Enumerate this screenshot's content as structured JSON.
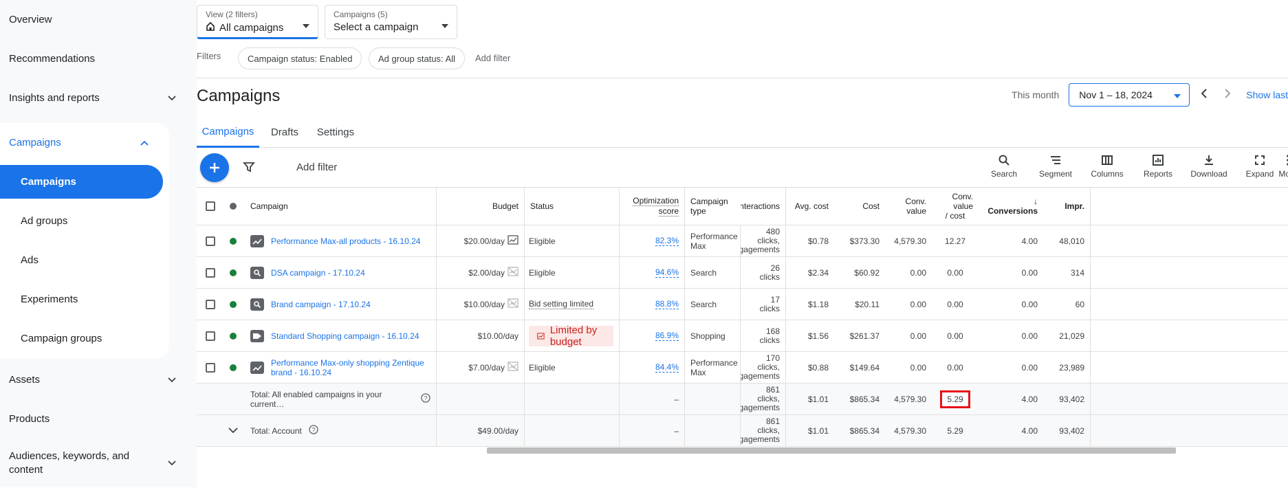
{
  "sidebar": {
    "overview": "Overview",
    "recommendations": "Recommendations",
    "insights": "Insights and reports",
    "campaigns_section": "Campaigns",
    "campaigns_children": [
      "Campaigns",
      "Ad groups",
      "Ads",
      "Experiments",
      "Campaign groups"
    ],
    "assets": "Assets",
    "products": "Products",
    "audiences": "Audiences, keywords, and content"
  },
  "view_dropdown": {
    "small": "View (2 filters)",
    "value": "All campaigns"
  },
  "campaigns_dropdown": {
    "small": "Campaigns (5)",
    "value": "Select a campaign"
  },
  "filters": {
    "label": "Filters",
    "chips": [
      "Campaign status: Enabled",
      "Ad group status: All"
    ],
    "add": "Add filter"
  },
  "page_title": "Campaigns",
  "date": {
    "label": "This month",
    "range": "Nov 1 – 18, 2024",
    "show_last": "Show last"
  },
  "tabs": [
    "Campaigns",
    "Drafts",
    "Settings"
  ],
  "toolbar": {
    "add_filter": "Add filter",
    "tools": [
      "Search",
      "Segment",
      "Columns",
      "Reports",
      "Download",
      "Expand",
      "More"
    ]
  },
  "table": {
    "headers": {
      "campaign": "Campaign",
      "budget": "Budget",
      "status": "Status",
      "opt_line1": "Optimization",
      "opt_line2": "score",
      "type_line1": "Campaign",
      "type_line2": "type",
      "interactions": "Interactions",
      "avg_cost": "Avg. cost",
      "cost": "Cost",
      "conv_value": "Conv. value",
      "cvc_line1": "Conv. value",
      "cvc_line2": "/ cost",
      "conversions": "Conversions",
      "impr": "Impr."
    },
    "rows": [
      {
        "name": "Performance Max-all products - 16.10.24",
        "icon": "performance-max-icon",
        "budget": "$20.00/day",
        "status": "Eligible",
        "opt": "82.3%",
        "type": "Performance Max",
        "int1": "480",
        "int2": "clicks,",
        "int3": "engagements",
        "avg": "$0.78",
        "cost": "$373.30",
        "cv": "4,579.30",
        "cvc": "12.27",
        "conv": "4.00",
        "impr": "48,010"
      },
      {
        "name": "DSA campaign - 17.10.24",
        "icon": "search-campaign-icon",
        "budget": "$2.00/day",
        "status": "Eligible",
        "opt": "94.6%",
        "type": "Search",
        "int1": "26",
        "int2": "clicks",
        "int3": "",
        "avg": "$2.34",
        "cost": "$60.92",
        "cv": "0.00",
        "cvc": "0.00",
        "conv": "0.00",
        "impr": "314"
      },
      {
        "name": "Brand campaign - 17.10.24",
        "icon": "search-campaign-icon",
        "budget": "$10.00/day",
        "status": "Bid setting limited",
        "opt": "88.8%",
        "type": "Search",
        "int1": "17",
        "int2": "clicks",
        "int3": "",
        "avg": "$1.18",
        "cost": "$20.11",
        "cv": "0.00",
        "cvc": "0.00",
        "conv": "0.00",
        "impr": "60"
      },
      {
        "name": "Standard Shopping campaign - 16.10.24",
        "icon": "shopping-tag-icon",
        "budget": "$10.00/day",
        "status": "Limited by budget",
        "opt": "86.9%",
        "type": "Shopping",
        "int1": "168",
        "int2": "clicks",
        "int3": "",
        "avg": "$1.56",
        "cost": "$261.37",
        "cv": "0.00",
        "cvc": "0.00",
        "conv": "0.00",
        "impr": "21,029"
      },
      {
        "name": "Performance Max-only shopping Zentique brand - 16.10.24",
        "icon": "performance-max-icon",
        "budget": "$7.00/day",
        "status": "Eligible",
        "opt": "84.4%",
        "type": "Performance Max",
        "int1": "170",
        "int2": "clicks,",
        "int3": "engagements",
        "avg": "$0.88",
        "cost": "$149.64",
        "cv": "0.00",
        "cvc": "0.00",
        "conv": "0.00",
        "impr": "23,989"
      }
    ],
    "total_enabled": {
      "label": "Total: All enabled campaigns in your current…",
      "opt": "–",
      "int1": "861",
      "int2": "clicks,",
      "int3": "engagements",
      "avg": "$1.01",
      "cost": "$865.34",
      "cv": "4,579.30",
      "cvc": "5.29",
      "conv": "4.00",
      "impr": "93,402"
    },
    "total_account": {
      "label": "Total: Account",
      "budget": "$49.00/day",
      "opt": "–",
      "int1": "861",
      "int2": "clicks,",
      "int3": "engagements",
      "avg": "$1.01",
      "cost": "$865.34",
      "cv": "4,579.30",
      "cvc": "5.29",
      "conv": "4.00",
      "impr": "93,402"
    }
  },
  "colors": {
    "accent": "#1a73e8",
    "enabled": "#188038",
    "limited_bg": "#fce8e6",
    "limited_text": "#c5221f",
    "highlight": "#e8111a"
  }
}
